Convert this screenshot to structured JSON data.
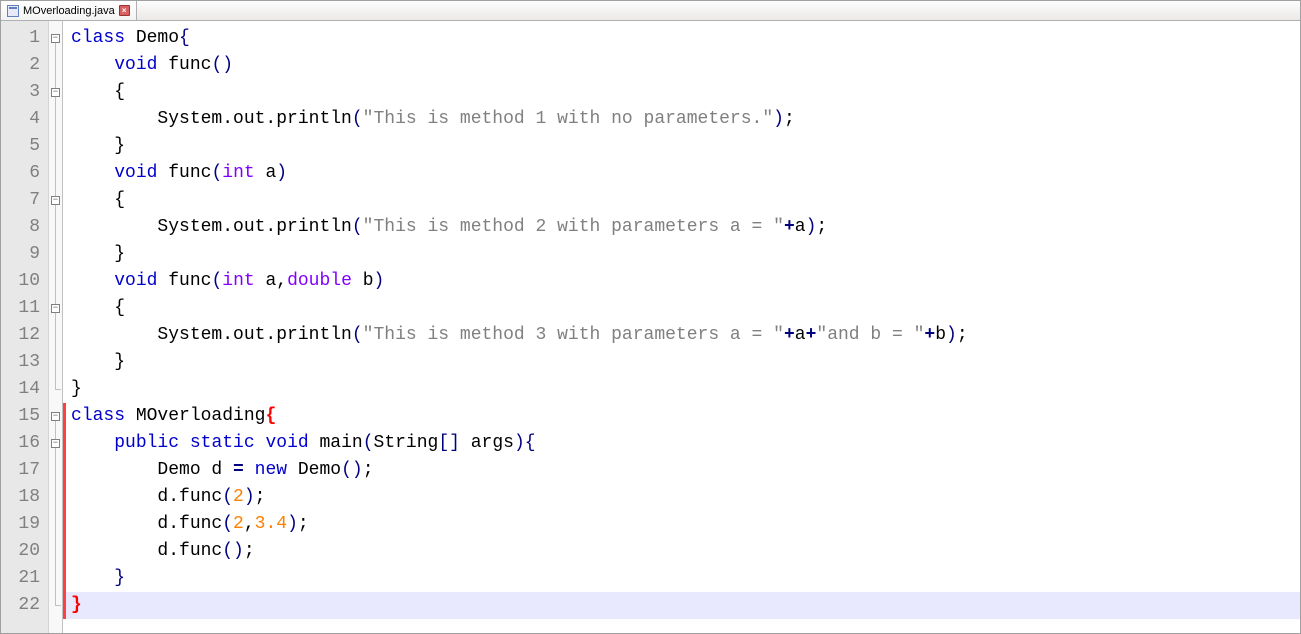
{
  "tab": {
    "filename": "MOverloading.java"
  },
  "gutter": {
    "lines": 22
  },
  "fold": {
    "boxes": [
      1,
      3,
      7,
      11,
      15,
      16
    ],
    "ends": [
      14,
      22
    ],
    "vlines": [
      2,
      4,
      5,
      6,
      8,
      9,
      10,
      12,
      13,
      17,
      18,
      19,
      20,
      21
    ]
  },
  "tokens": {
    "kw_class": "class",
    "kw_void": "void",
    "kw_int": "int",
    "kw_double": "double",
    "kw_public": "public",
    "kw_static": "static",
    "kw_new": "new",
    "id_Demo": "Demo",
    "id_func": "func",
    "id_a": "a",
    "id_b": "b",
    "id_MOverloading": "MOverloading",
    "id_main": "main",
    "id_String": "String",
    "id_args": "args",
    "id_d": "d",
    "id_System": "System",
    "id_out": "out",
    "id_println": "println",
    "str1": "\"This is method 1 with no parameters.\"",
    "str2": "\"This is method 2 with parameters a = \"",
    "str3a": "\"This is method 3 with parameters a = \"",
    "str3b": "\"and b = \"",
    "num_2": "2",
    "num_3_4": "3.4",
    "sym_lbrace": "{",
    "sym_rbrace": "}",
    "sym_lparen": "(",
    "sym_rparen": ")",
    "sym_lbracket": "[",
    "sym_rbracket": "]",
    "sym_semi": ";",
    "sym_comma": ",",
    "sym_dot": ".",
    "sym_eq": "=",
    "sym_plus": "+"
  },
  "modified_lines": {
    "start": 15,
    "end": 22
  },
  "highlight_line": 22
}
